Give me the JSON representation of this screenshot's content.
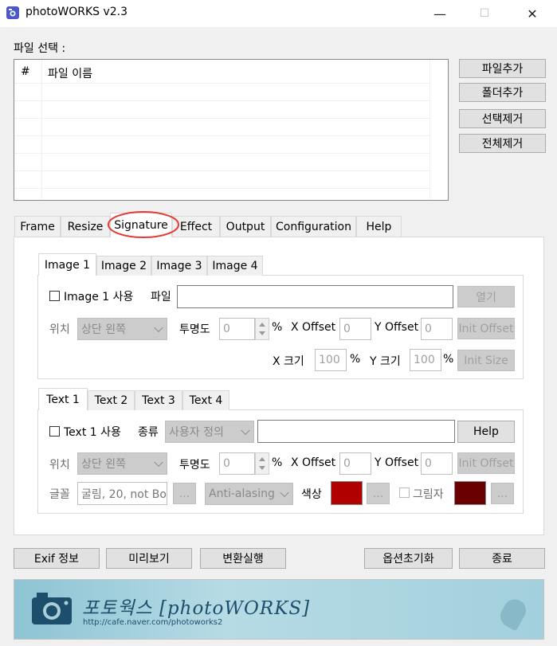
{
  "window": {
    "title": "photoWORKS v2.3",
    "min": "—",
    "max": "☐",
    "close": "✕"
  },
  "file_section": {
    "label": "파일 선택 :",
    "columns": [
      "#",
      "파일 이름"
    ],
    "buttons": {
      "add_file": "파일추가",
      "add_folder": "폴더추가",
      "remove_selected": "선택제거",
      "remove_all": "전체제거"
    }
  },
  "main_tabs": [
    "Frame",
    "Resize",
    "Signature",
    "Effect",
    "Output",
    "Configuration",
    "Help"
  ],
  "selected_main_tab": "Signature",
  "image_section": {
    "tabs": [
      "Image 1",
      "Image 2",
      "Image 3",
      "Image 4"
    ],
    "use_label": "Image 1 사용",
    "file_label": "파일",
    "open_button": "열기",
    "position_label": "위치",
    "position_value": "상단 왼쪽",
    "opacity_label": "투명도",
    "opacity_value": "0",
    "percent": "%",
    "x_offset_label": "X Offset",
    "x_offset_value": "0",
    "y_offset_label": "Y Offset",
    "y_offset_value": "0",
    "init_offset_button": "Init Offset",
    "x_size_label": "X 크기",
    "x_size_value": "100",
    "y_size_label": "Y 크기",
    "y_size_value": "100",
    "init_size_button": "Init Size"
  },
  "text_section": {
    "tabs": [
      "Text 1",
      "Text 2",
      "Text 3",
      "Text 4"
    ],
    "use_label": "Text 1 사용",
    "type_label": "종류",
    "type_value": "사용자 정의",
    "help_button": "Help",
    "position_label": "위치",
    "position_value": "상단 왼쪽",
    "opacity_label": "투명도",
    "opacity_value": "0",
    "percent": "%",
    "x_offset_label": "X Offset",
    "x_offset_value": "0",
    "y_offset_label": "Y Offset",
    "y_offset_value": "0",
    "init_offset_button": "Init Offset",
    "font_label": "글꼴",
    "font_value": "굴림, 20, not Bo",
    "ellipsis": "...",
    "antialias_value": "Anti-alasing",
    "color_label": "색상",
    "color_value": "#b00000",
    "shadow_label": "그림자",
    "shadow_color": "#6a0000"
  },
  "bottom_buttons": {
    "exif": "Exif 정보",
    "preview": "미리보기",
    "convert": "변환실행",
    "reset_options": "옵션초기화",
    "exit": "종료"
  },
  "banner": {
    "title": "포토웍스 [photoWORKS]",
    "url": "http://cafe.naver.com/photoworks2"
  }
}
